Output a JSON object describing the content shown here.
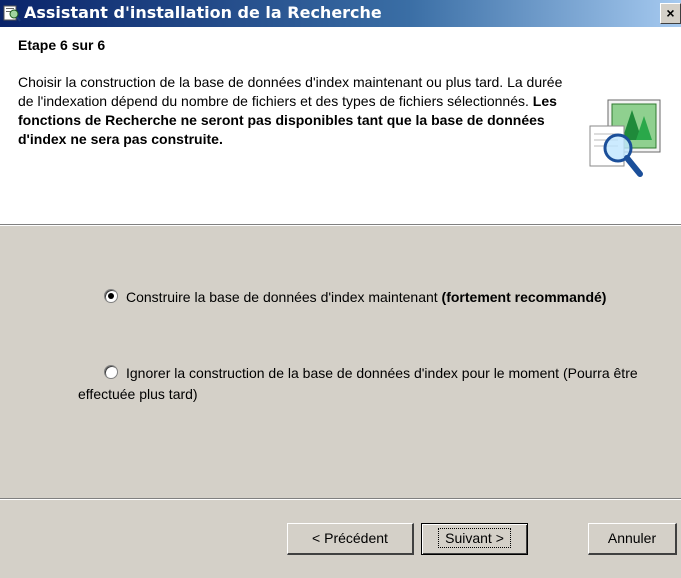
{
  "window": {
    "title": "Assistant d'installation de la Recherche",
    "close_glyph": "×",
    "icon": "search-wizard-icon"
  },
  "header": {
    "step": "Etape 6 sur 6",
    "description_normal": "Choisir la construction de la base de données d'index maintenant ou plus tard. La durée de l'indexation dépend du nombre de fichiers et des types de fichiers sélectionnés. ",
    "description_bold": "Les fonctions de Recherche ne seront pas disponibles tant que la base de données d'index ne sera pas construite.",
    "icon": "document-magnifier-icon"
  },
  "options": [
    {
      "label_normal": "Construire la base de données d'index maintenant ",
      "label_bold": "(fortement recommandé)",
      "checked": true
    },
    {
      "label_normal": "Ignorer la construction de la base de données d'index pour le moment (Pourra être effectuée plus tard)",
      "label_bold": "",
      "checked": false
    }
  ],
  "buttons": {
    "previous": "< Précédent",
    "next": "Suivant >",
    "cancel": "Annuler"
  },
  "colors": {
    "titlebar_start": "#0a246a",
    "titlebar_end": "#a6caf0",
    "dialog_bg": "#d4d0c8",
    "header_bg": "#ffffff"
  }
}
